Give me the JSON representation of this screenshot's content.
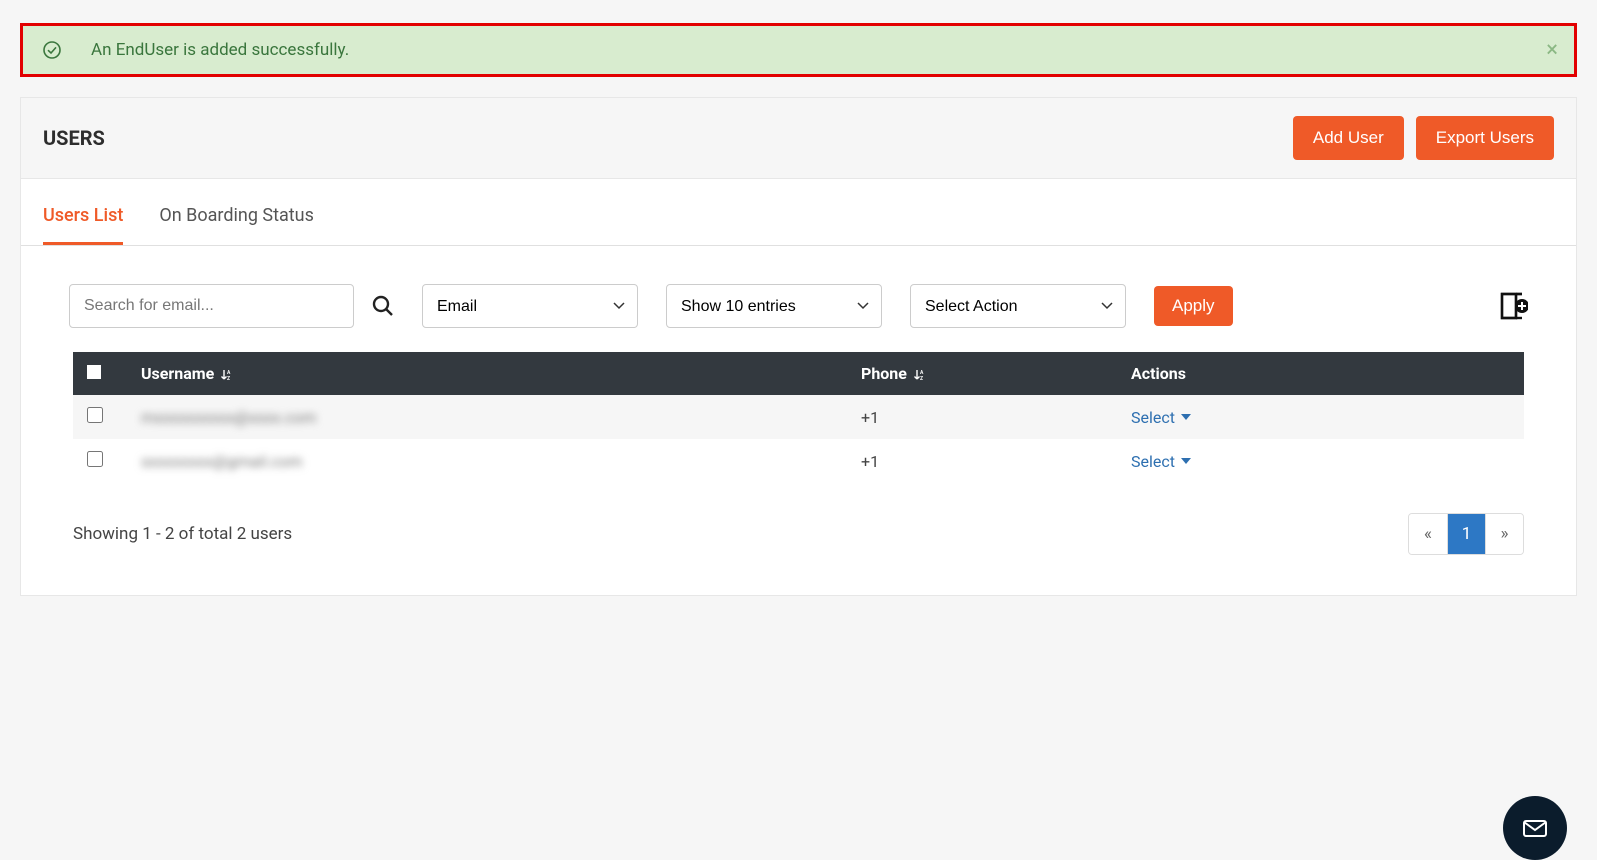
{
  "alert": {
    "message": "An EndUser is added successfully.",
    "close_symbol": "×"
  },
  "header": {
    "title": "USERS",
    "add_user_label": "Add User",
    "export_users_label": "Export Users"
  },
  "tabs": [
    {
      "label": "Users List",
      "active": true
    },
    {
      "label": "On Boarding Status",
      "active": false
    }
  ],
  "filters": {
    "search_placeholder": "Search for email...",
    "email_select": "Email",
    "entries_select": "Show 10 entries",
    "action_select": "Select Action",
    "apply_label": "Apply"
  },
  "table": {
    "columns": {
      "username": "Username",
      "phone": "Phone",
      "actions": "Actions"
    },
    "rows": [
      {
        "username": "mxxxxxxxxxx@xxxx.com",
        "phone": "+1",
        "action_label": "Select"
      },
      {
        "username": "sxxxxxxxx@gmail.com",
        "phone": "+1",
        "action_label": "Select"
      }
    ]
  },
  "footer": {
    "showing_text": "Showing 1 - 2 of total 2 users",
    "pager_prev": "«",
    "pager_page": "1",
    "pager_next": "»"
  }
}
